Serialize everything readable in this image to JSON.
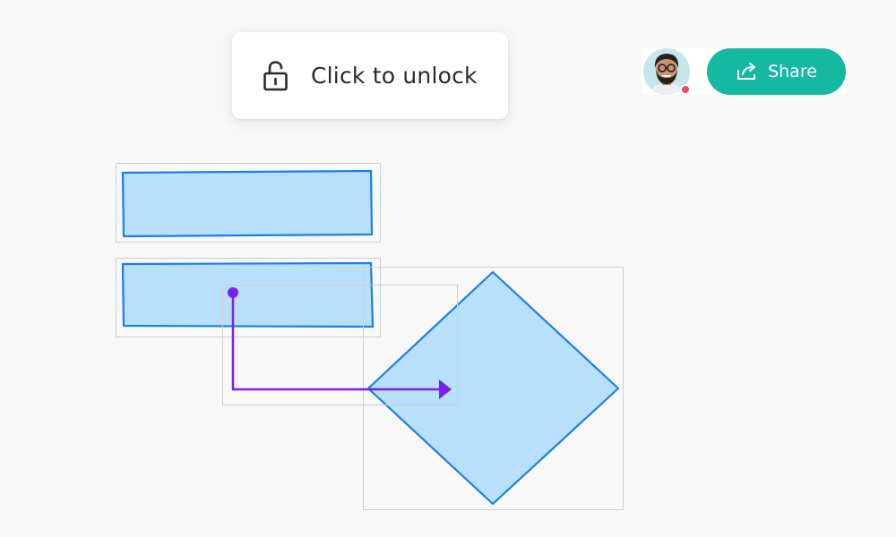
{
  "lock_popup": {
    "icon": "unlock-padlock-icon",
    "label": "Click to unlock"
  },
  "collaborator": {
    "avatar": "user-avatar",
    "status": "online-indicator",
    "status_color": "#f0456c"
  },
  "share_button": {
    "icon": "share-arrow-icon",
    "label": "Share",
    "color": "#15b8a0"
  },
  "canvas": {
    "shape_fill": "#b8e0fb",
    "shape_stroke": "#1c7ee8",
    "arrow_color": "#7a21f0",
    "selection_color": "#cfcfd2",
    "shapes": [
      "rectangle",
      "rectangle",
      "diamond",
      "elbow-arrow"
    ]
  }
}
